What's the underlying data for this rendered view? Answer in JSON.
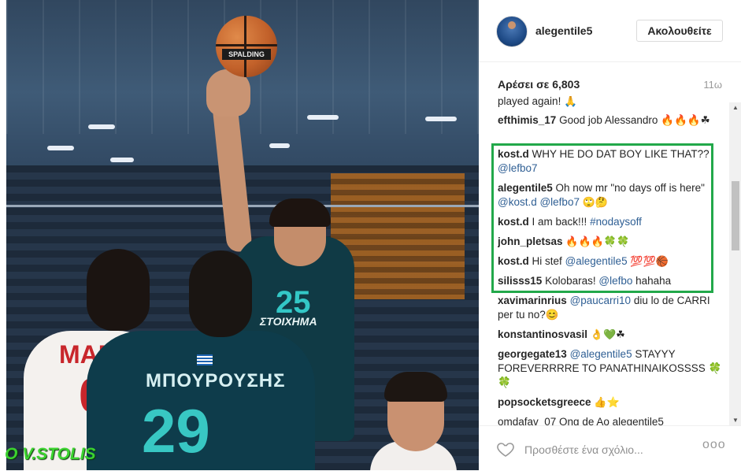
{
  "photo": {
    "watermark": "O V.STOLIS",
    "ball_label": "SPALDING",
    "shooter_number": "25",
    "shooter_sponsor": "ΣΤΟΙΧΗΜΑ",
    "back_player_name": "ΜΠΟΥΡΟΥΣΗΣ",
    "back_player_number": "29",
    "red_player_name": "MARAS",
    "red_player_number": "0"
  },
  "header": {
    "username": "alegentile5",
    "follow_label": "Ακολουθείτε"
  },
  "post": {
    "likes": "Αρέσει σε 6,803",
    "time": "11ω"
  },
  "comments": [
    {
      "user": "",
      "text": "played again! 🙏"
    },
    {
      "user": "efthimis_17",
      "text": "Good job Alessandro 🔥🔥🔥☘"
    },
    {
      "user": "kost.d",
      "text": "WHY HE DO DAT BOY LIKE THAT??",
      "mention": "@lefbo7"
    },
    {
      "user": "alegentile5",
      "text": "Oh now mr \"no days off is here\"",
      "mention": "@kost.d @lefbo7",
      "after": "🙄🤔"
    },
    {
      "user": "kost.d",
      "text": "I am back!!!",
      "mention": "#nodaysoff"
    },
    {
      "user": "john_pletsas",
      "text": "🔥🔥🔥🍀🍀"
    },
    {
      "user": "kost.d",
      "text": "Hi stef",
      "mention": "@alegentile5",
      "after": "💯💯🏀"
    },
    {
      "user": "silisss15",
      "text": "Kolobaras!",
      "mention": "@lefbo",
      "after": "hahaha"
    },
    {
      "user": "xavimarinrius",
      "text": "",
      "mention": "@paucarri10",
      "after": "diu lo de CARRI per tu no?😊"
    },
    {
      "user": "konstantinosvasil",
      "text": "👌💚☘"
    },
    {
      "user": "georgegate13",
      "text": "",
      "mention": "@alegentile5",
      "after": "STAYYY FOREVERRRRE TO PANATHINAIKOSSSS 🍀🍀"
    },
    {
      "user": "popsocketsgreece",
      "text": "👍⭐"
    },
    {
      "user": "",
      "text": "omdafav_07 Ong de Ao alegentile5"
    }
  ],
  "footer": {
    "comment_placeholder": "Προσθέστε ένα σχόλιο...",
    "more_label": "ooo"
  }
}
